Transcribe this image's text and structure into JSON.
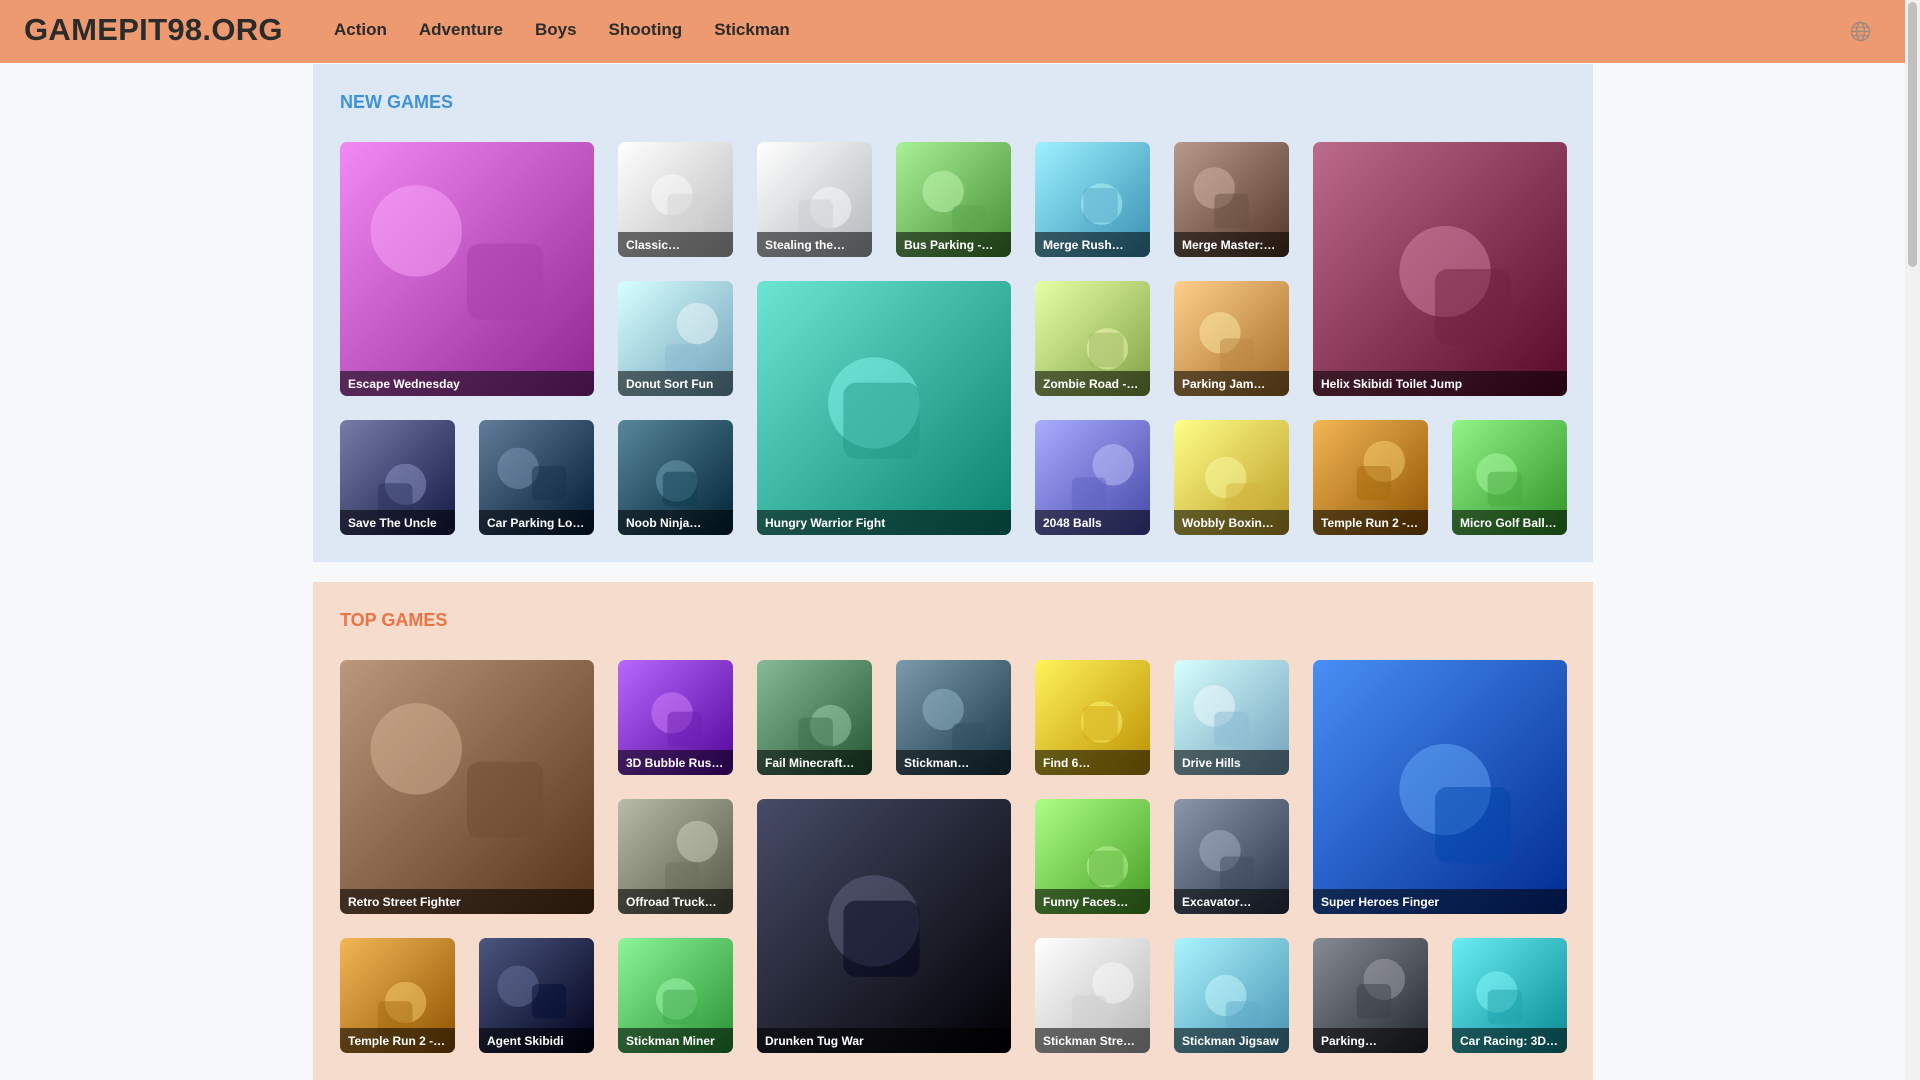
{
  "header": {
    "logo": "GAMEPIT98.ORG",
    "nav": [
      "Action",
      "Adventure",
      "Boys",
      "Shooting",
      "Stickman"
    ],
    "language_icon": "globe-icon"
  },
  "new_games": {
    "title": "NEW GAMES",
    "tiles": [
      {
        "label": "Escape Wednesday",
        "color": "#c65cc8"
      },
      {
        "label": "Classic…",
        "color": "#f2f2f2"
      },
      {
        "label": "Stealing the…",
        "color": "#e9eef2"
      },
      {
        "label": "Bus Parking -…",
        "color": "#7cc46a"
      },
      {
        "label": "Merge Rush…",
        "color": "#6fc5e8"
      },
      {
        "label": "Merge Master:…",
        "color": "#8a6d5e"
      },
      {
        "label": "Helix Skibidi Toilet Jump",
        "color": "#8e3f5e"
      },
      {
        "label": "Donut Sort Fun",
        "color": "#a9d8ef"
      },
      {
        "label": "Hungry Warrior Fight",
        "color": "#3fb8a6"
      },
      {
        "label": "Zombie Road -…",
        "color": "#b9d87a"
      },
      {
        "label": "Parking Jam…",
        "color": "#d9a35e"
      },
      {
        "label": "Save The Uncle",
        "color": "#4a4f7c"
      },
      {
        "label": "Car Parking Lo…",
        "color": "#35506c"
      },
      {
        "label": "Noob Ninja…",
        "color": "#2c5a6e"
      },
      {
        "label": "2048 Balls",
        "color": "#7d7fe0"
      },
      {
        "label": "Wobbly Boxin…",
        "color": "#f2d25c"
      },
      {
        "label": "Temple Run 2 -…",
        "color": "#c68a2a"
      },
      {
        "label": "Micro Golf Ball…",
        "color": "#65c85c"
      }
    ]
  },
  "top_games": {
    "title": "TOP GAMES",
    "tiles": [
      {
        "label": "Retro Street Fighter",
        "color": "#8e6a4e"
      },
      {
        "label": "3D Bubble Rus…",
        "color": "#8a3bd0"
      },
      {
        "label": "Fail Minecraft…",
        "color": "#5a8e6a"
      },
      {
        "label": "Stickman…",
        "color": "#4e6e7e"
      },
      {
        "label": "Find 6…",
        "color": "#f2c62e"
      },
      {
        "label": "Drive Hills",
        "color": "#a9d8f2"
      },
      {
        "label": "Super Heroes Finger",
        "color": "#1c62c8"
      },
      {
        "label": "Offroad Truck…",
        "color": "#8a8e7a"
      },
      {
        "label": "Drunken Tug War",
        "color": "#1a1f3a"
      },
      {
        "label": "Funny Faces…",
        "color": "#7ed35a"
      },
      {
        "label": "Excavator…",
        "color": "#5e6a7e"
      },
      {
        "label": "Temple Run 2 -…",
        "color": "#c68a2a"
      },
      {
        "label": "Agent Skibidi",
        "color": "#1e2a52"
      },
      {
        "label": "Stickman Miner",
        "color": "#5ec86a"
      },
      {
        "label": "Stickman Stre…",
        "color": "#eeeeee"
      },
      {
        "label": "Stickman Jigsaw",
        "color": "#7ec8e8"
      },
      {
        "label": "Parking…",
        "color": "#5a5e66"
      },
      {
        "label": "Car Racing: 3D…",
        "color": "#3ec0c8"
      }
    ]
  }
}
